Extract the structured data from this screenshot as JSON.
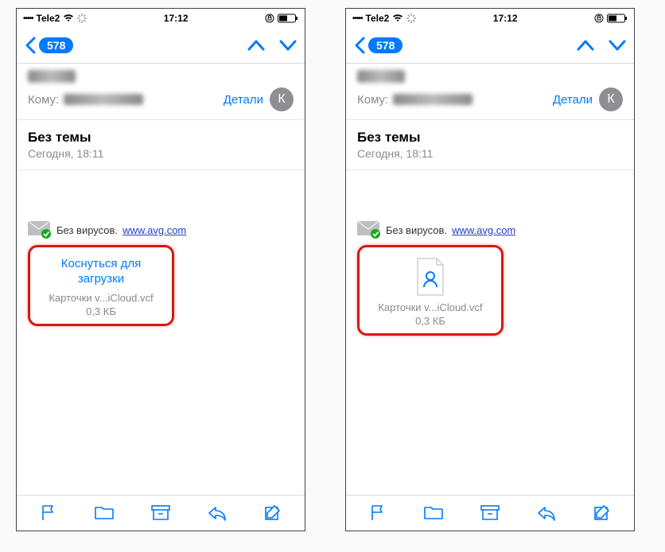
{
  "status": {
    "carrier": "Tele2",
    "time": "17:12",
    "signal_dots": "•••••"
  },
  "nav": {
    "badge": "578"
  },
  "header": {
    "to_label": "Кому:",
    "details": "Детали",
    "avatar_letter": "К"
  },
  "subject_block": {
    "subject": "Без темы",
    "date": "Сегодня, 18:11"
  },
  "virus": {
    "text": "Без вирусов.",
    "link": "www.avg.com"
  },
  "attachment_left": {
    "tap_line1": "Коснуться для",
    "tap_line2": "загрузки",
    "filename": "Карточки v...iCloud.vcf",
    "filesize": "0,3 КБ"
  },
  "attachment_right": {
    "filename": "Карточки v...iCloud.vcf",
    "filesize": "0,3 КБ"
  }
}
